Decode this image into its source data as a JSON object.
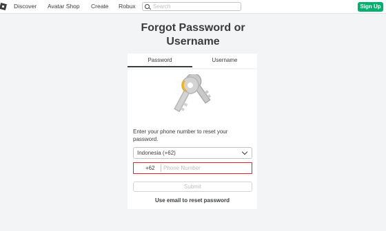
{
  "header": {
    "logo_icon": "roblox-logo-icon",
    "nav": [
      "Discover",
      "Avatar Shop",
      "Create",
      "Robux"
    ],
    "search": {
      "placeholder": "Search",
      "icon": "search-icon"
    },
    "signup_label": "Sign Up",
    "signup_color": "#00b06f"
  },
  "page": {
    "title_line1": "Forgot Password or",
    "title_line2": "Username"
  },
  "tabs": [
    {
      "label": "Password",
      "selected": true
    },
    {
      "label": "Username",
      "selected": false
    }
  ],
  "illustration": {
    "icon": "keys-icon"
  },
  "form": {
    "prompt": "Enter your phone number to reset your password.",
    "country_value": "Indonesia (+62)",
    "phone_prefix": "+62",
    "phone_placeholder": "Phone Number",
    "phone_border_color": "#e0211f",
    "submit_label": "Submit",
    "alt_link": "Use email to reset password"
  }
}
